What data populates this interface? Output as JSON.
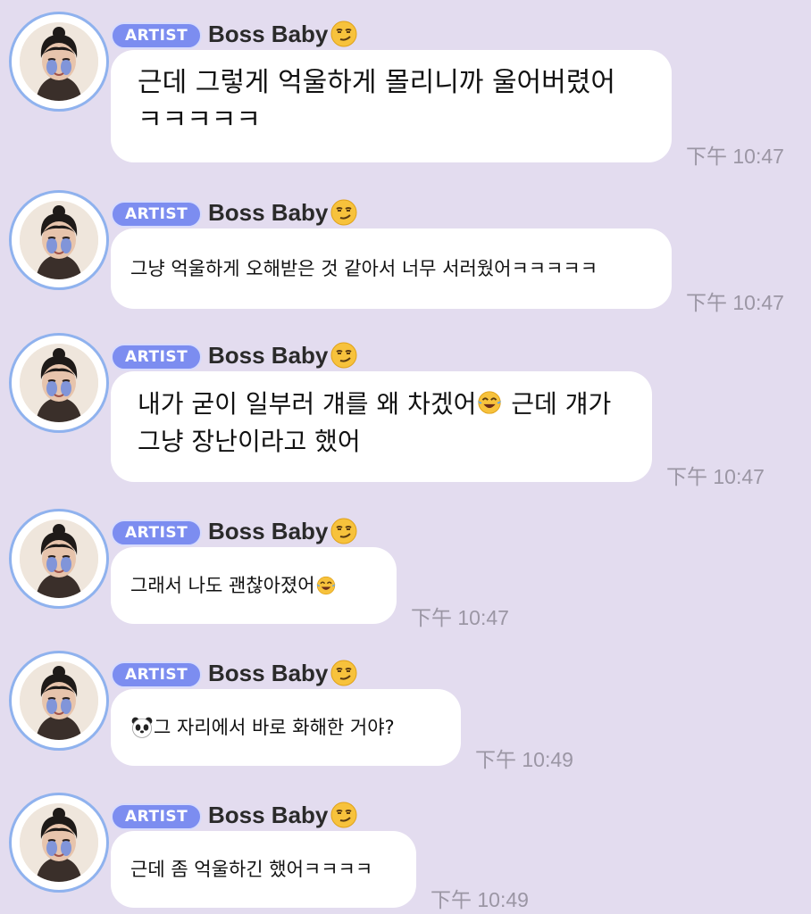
{
  "chat": {
    "messages": [
      {
        "badge": "ARTIST",
        "sender": "Boss Baby",
        "lines": [
          "근데 그렇게 억울하게 몰리니까 울어버렸어",
          "ㅋㅋㅋㅋㅋ"
        ],
        "time": "下午 10:47"
      },
      {
        "badge": "ARTIST",
        "sender": "Boss Baby",
        "text": "그냥 억울하게 오해받은 것 같아서 너무 서러웠어ㅋㅋㅋㅋㅋ",
        "time": "下午 10:47"
      },
      {
        "badge": "ARTIST",
        "sender": "Boss Baby",
        "line1": "내가 굳이 일부러 걔를 왜 차겠어",
        "line1_after": " 근데 걔가",
        "line2": "그냥 장난이라고 했어",
        "time": "下午 10:47"
      },
      {
        "badge": "ARTIST",
        "sender": "Boss Baby",
        "text": "그래서 나도 괜찮아졌어",
        "time": "下午 10:47"
      },
      {
        "badge": "ARTIST",
        "sender": "Boss Baby",
        "text": "그 자리에서 바로 화해한 거야?",
        "time": "下午 10:49"
      },
      {
        "badge": "ARTIST",
        "sender": "Boss Baby",
        "text": "근데 좀 억울하긴 했어ㅋㅋㅋㅋ",
        "time": "下午 10:49"
      }
    ]
  },
  "icons": {
    "sender_emoji": "smirking-face-icon",
    "laugh_emoji": "tears-of-joy-icon",
    "panda_emoji": "panda-icon",
    "avatar": "artist-avatar"
  },
  "colors": {
    "background": "#e3dcef",
    "badge": "#7c8df0",
    "avatar_ring": "#8fb2ee",
    "bubble": "#ffffff",
    "time": "#9b96a4"
  }
}
